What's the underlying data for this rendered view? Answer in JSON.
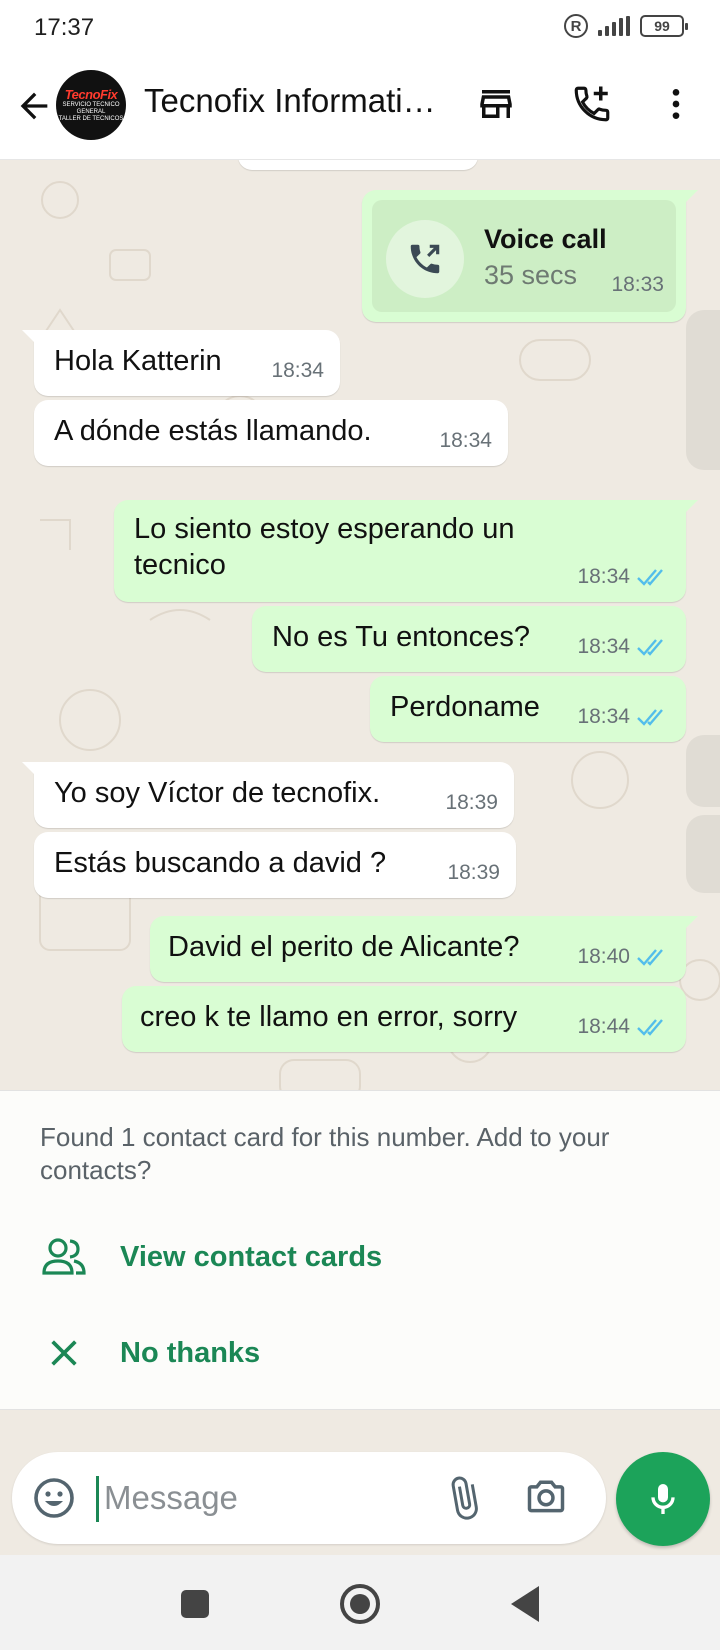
{
  "status_bar": {
    "time": "17:37",
    "registered_icon": "registered-icon",
    "signal_icon": "signal-icon",
    "battery_level": "99"
  },
  "header": {
    "title": "Tecnofix Informati…",
    "avatar_logo_text": "TecnoFix",
    "avatar_logo_lines": [
      "SERVICIO TECNICO",
      "GENERAL",
      "TALLER DE TECNICOS"
    ],
    "icons": {
      "back": "back-arrow-icon",
      "store": "store-icon",
      "add_call": "add-call-icon",
      "menu": "more-vert-icon"
    }
  },
  "messages": [
    {
      "type": "voice_call",
      "direction": "out",
      "title": "Voice call",
      "duration": "35 secs",
      "time": "18:33"
    },
    {
      "direction": "in",
      "text": "Hola Katterin",
      "time": "18:34"
    },
    {
      "direction": "in",
      "text": "A dónde estás llamando.",
      "time": "18:34"
    },
    {
      "direction": "out",
      "lines": [
        "Lo siento estoy esperando un",
        "tecnico"
      ],
      "time": "18:34",
      "status": "read"
    },
    {
      "direction": "out",
      "text": "No es Tu entonces?",
      "time": "18:34",
      "status": "read"
    },
    {
      "direction": "out",
      "text": "Perdoname",
      "time": "18:34",
      "status": "read"
    },
    {
      "direction": "in",
      "text": "Yo soy Víctor de tecnofix.",
      "time": "18:39"
    },
    {
      "direction": "in",
      "text": "Estás buscando a david ?",
      "time": "18:39"
    },
    {
      "direction": "out",
      "text": "David el perito de Alicante?",
      "time": "18:40",
      "status": "read"
    },
    {
      "direction": "out",
      "text": "creo k te llamo en error, sorry",
      "time": "18:44",
      "status": "read"
    }
  ],
  "contact_card_panel": {
    "text": "Found 1 contact card for this number. Add to your contacts?",
    "view_label": "View contact cards",
    "dismiss_label": "No thanks",
    "view_icon": "contacts-icon",
    "dismiss_icon": "close-icon"
  },
  "input_bar": {
    "placeholder": "Message",
    "value": "",
    "icons": [
      "emoji-icon",
      "attach-icon",
      "camera-icon",
      "mic-icon"
    ]
  },
  "nav_bar": {
    "icons": [
      "recents-icon",
      "home-icon",
      "back-icon"
    ]
  },
  "colors": {
    "chat_background": "#efeae2",
    "outgoing_bubble": "#d9fdd3",
    "incoming_bubble": "#ffffff",
    "accent_green": "#1b8755",
    "mic_button": "#1ca35a",
    "read_ticks": "#53bdeb"
  }
}
